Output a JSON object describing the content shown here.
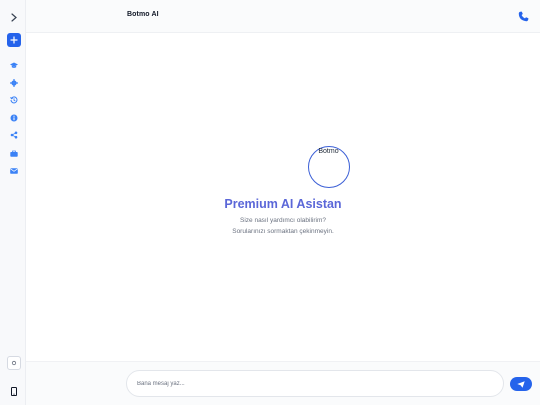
{
  "header": {
    "title": "Botmo AI"
  },
  "welcome": {
    "logo_text": "Botmo",
    "title": "Premium AI Asistan",
    "line1": "Size nasıl yardımcı olabilirim?",
    "line2": "Sorularınızı sormaktan çekinmeyin."
  },
  "composer": {
    "placeholder": "Bana mesaj yaz..."
  },
  "sidebar": {
    "items": [
      {
        "icon": "graduation-cap-icon"
      },
      {
        "icon": "gear-icon"
      },
      {
        "icon": "history-icon"
      },
      {
        "icon": "info-icon"
      },
      {
        "icon": "share-icon"
      },
      {
        "icon": "briefcase-icon"
      },
      {
        "icon": "envelope-icon"
      }
    ]
  },
  "colors": {
    "accent": "#2563eb",
    "title": "#5b67d8",
    "sidebar_icon": "#3b82f6"
  }
}
